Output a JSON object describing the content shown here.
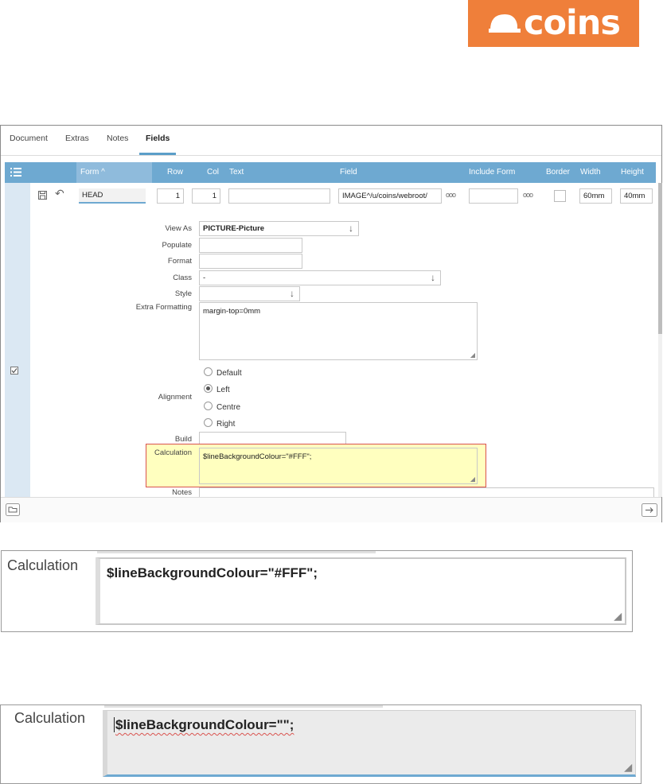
{
  "logo": {
    "text": "coins",
    "color": "#ef7f3a"
  },
  "tabs": [
    {
      "label": "Document",
      "active": false
    },
    {
      "label": "Extras",
      "active": false
    },
    {
      "label": "Notes",
      "active": false
    },
    {
      "label": "Fields",
      "active": true
    }
  ],
  "grid": {
    "headers": {
      "form": "Form",
      "row": "Row",
      "col": "Col",
      "text": "Text",
      "field": "Field",
      "include_form": "Include Form",
      "border": "Border",
      "width": "Width",
      "height": "Height"
    },
    "sort_icon": "chevron-up-icon",
    "row": {
      "form": "HEAD",
      "row": "1",
      "col": "1",
      "text": "",
      "field": "IMAGE^/u/coins/webroot/",
      "include_form": "",
      "border": false,
      "width": "60mm",
      "height": "40mm"
    }
  },
  "details": {
    "view_as": {
      "label": "View As",
      "value": "PICTURE-Picture"
    },
    "populate": {
      "label": "Populate",
      "value": ""
    },
    "format": {
      "label": "Format",
      "value": ""
    },
    "class": {
      "label": "Class",
      "value": "-"
    },
    "style": {
      "label": "Style",
      "value": ""
    },
    "extra_formatting": {
      "label": "Extra Formatting",
      "value": "margin-top=0mm"
    },
    "alignment": {
      "label": "Alignment",
      "options": [
        "Default",
        "Left",
        "Centre",
        "Right"
      ],
      "selected": "Left"
    },
    "build": {
      "label": "Build",
      "value": ""
    },
    "calculation": {
      "label": "Calculation",
      "value": "$lineBackgroundColour=\"#FFF\";"
    },
    "notes": {
      "label": "Notes",
      "value": ""
    }
  },
  "zoom1": {
    "label": "Calculation",
    "value": "$lineBackgroundColour=\"#FFF\";"
  },
  "zoom2": {
    "label": "Calculation",
    "value": "$lineBackgroundColour=\"\";"
  },
  "colors": {
    "accent": "#6ea9d1",
    "highlight": "#ffffbf",
    "error_border": "#d9534f"
  }
}
